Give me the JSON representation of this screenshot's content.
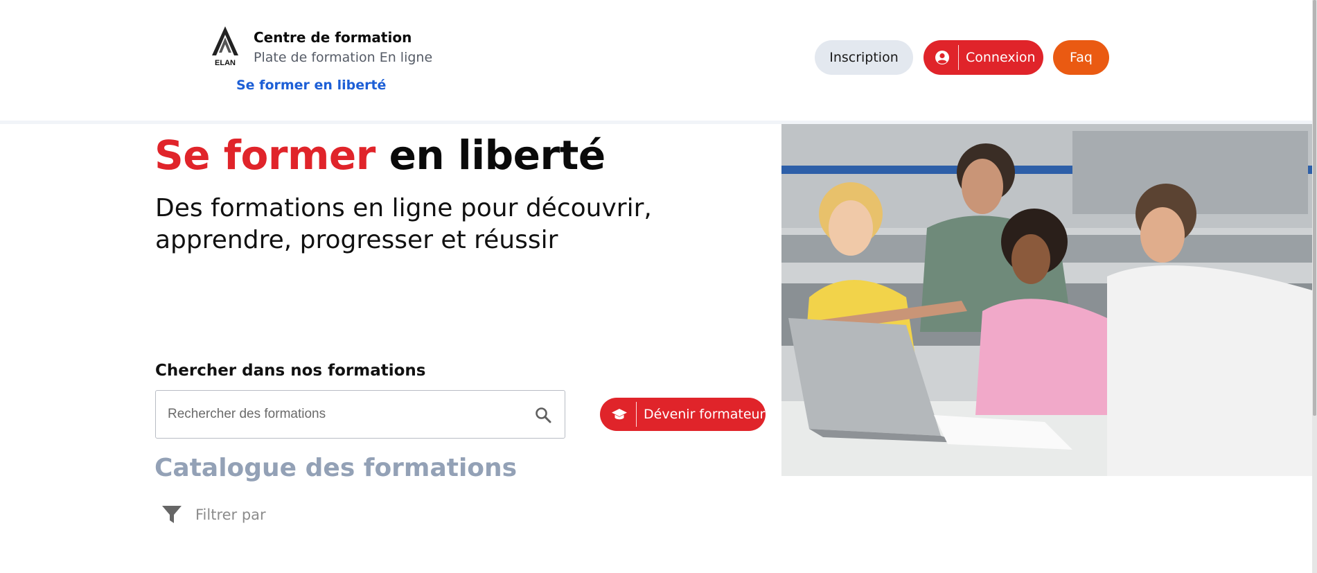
{
  "brand": {
    "title": "Centre de formation",
    "subtitle": "Plate de formation En ligne",
    "tagline": "Se former en liberté",
    "logo_text": "ELAN"
  },
  "nav": {
    "inscription": "Inscription",
    "connexion": "Connexion",
    "faq": "Faq"
  },
  "hero": {
    "title_red": "Se former",
    "title_black": "en liberté",
    "subtitle": "Des formations en ligne pour découvrir, apprendre, progresser et réussir"
  },
  "search": {
    "label": "Chercher dans nos formations",
    "placeholder": "Rechercher des formations",
    "value": ""
  },
  "become_trainer": "Dévenir formateur",
  "catalogue": {
    "title": "Catalogue des formations",
    "filter_label": "Filtrer par"
  },
  "colors": {
    "red": "#e0242a",
    "orange": "#ea5a12",
    "blue": "#1d5fd6",
    "muted": "#93a1b6",
    "light_button": "#e3e8ef"
  },
  "icons": {
    "logo": "elan-logo",
    "user": "user-circle-icon",
    "search": "search-icon",
    "graduation": "graduation-cap-icon",
    "filter": "funnel-icon"
  }
}
